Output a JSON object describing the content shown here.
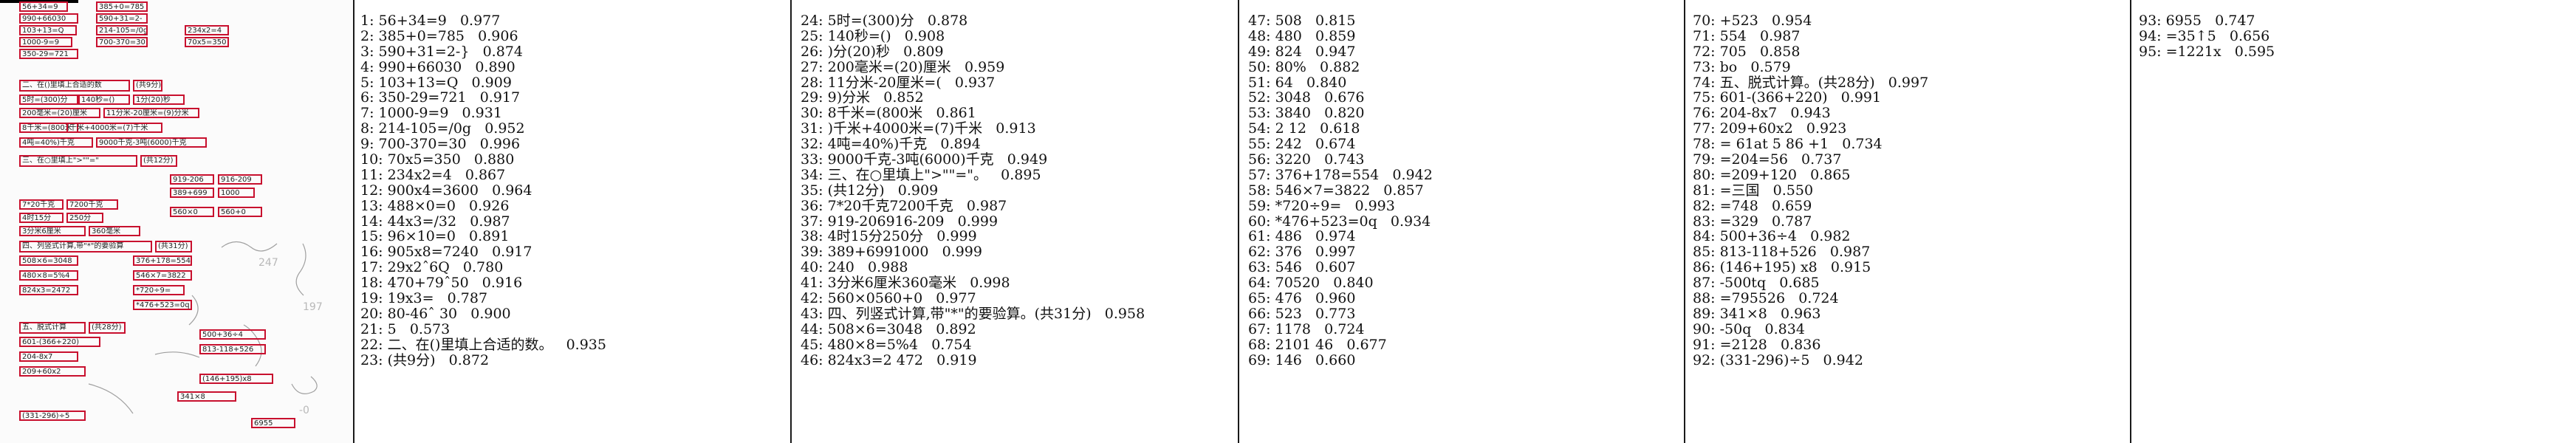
{
  "columns": [
    {
      "rows": [
        {
          "idx": "1:",
          "text": "56+34=9",
          "score": "0.977"
        },
        {
          "idx": "2:",
          "text": "385+0=785",
          "score": "0.906"
        },
        {
          "idx": "3:",
          "text": "590+31=2-}",
          "score": "0.874"
        },
        {
          "idx": "4:",
          "text": "990+66030",
          "score": "0.890"
        },
        {
          "idx": "5:",
          "text": "103+13=Q",
          "score": "0.909"
        },
        {
          "idx": "6:",
          "text": "350-29=721",
          "score": "0.917"
        },
        {
          "idx": "7:",
          "text": "1000-9=9",
          "score": "0.931"
        },
        {
          "idx": "8:",
          "text": "214-105=/0g",
          "score": "0.952"
        },
        {
          "idx": "9:",
          "text": "700-370=30",
          "score": "0.996"
        },
        {
          "idx": "10:",
          "text": "70x5=350",
          "score": "0.880"
        },
        {
          "idx": "11:",
          "text": "234x2=4",
          "score": "0.867"
        },
        {
          "idx": "12:",
          "text": "900x4=3600",
          "score": "0.964"
        },
        {
          "idx": "13:",
          "text": "488×0=0",
          "score": "0.926"
        },
        {
          "idx": "14:",
          "text": "44x3=/32",
          "score": "0.987"
        },
        {
          "idx": "15:",
          "text": "96×10=0",
          "score": "0.891"
        },
        {
          "idx": "16:",
          "text": "905x8=7240",
          "score": "0.917"
        },
        {
          "idx": "17:",
          "text": "29x2ˆ6Q",
          "score": "0.780"
        },
        {
          "idx": "18:",
          "text": "470+79ˆ50",
          "score": "0.916"
        },
        {
          "idx": "19:",
          "text": "19x3=",
          "score": "0.787"
        },
        {
          "idx": "20:",
          "text": "80-46ˆ 30",
          "score": "0.900"
        },
        {
          "idx": "21:",
          "text": "5",
          "score": "0.573"
        },
        {
          "idx": "22:",
          "text": "二、在()里填上合适的数。",
          "score": "0.935"
        },
        {
          "idx": "23:",
          "text": "(共9分)",
          "score": "0.872"
        }
      ]
    },
    {
      "rows": [
        {
          "idx": "24:",
          "text": "5时=(300)分",
          "score": "0.878"
        },
        {
          "idx": "25:",
          "text": "140秒=()",
          "score": "0.908"
        },
        {
          "idx": "26:",
          "text": ")分(20)秒",
          "score": "0.809"
        },
        {
          "idx": "27:",
          "text": "200毫米=(20)厘米",
          "score": "0.959"
        },
        {
          "idx": "28:",
          "text": "11分米-20厘米=(",
          "score": "0.937"
        },
        {
          "idx": "29:",
          "text": "9)分米",
          "score": "0.852"
        },
        {
          "idx": "30:",
          "text": "8千米=(800米",
          "score": "0.861"
        },
        {
          "idx": "31:",
          "text": ")千米+4000米=(7)千米",
          "score": "0.913"
        },
        {
          "idx": "32:",
          "text": "4吨=40%)千克",
          "score": "0.894"
        },
        {
          "idx": "33:",
          "text": "9000千克-3吨(6000)千克",
          "score": "0.949"
        },
        {
          "idx": "34:",
          "text": "三、在○里填上\">\"\"=\"。",
          "score": "0.895"
        },
        {
          "idx": "35:",
          "text": "(共12分)",
          "score": "0.909"
        },
        {
          "idx": "36:",
          "text": "7*20千克7200千克",
          "score": "0.987"
        },
        {
          "idx": "37:",
          "text": "919-206916-209",
          "score": "0.999"
        },
        {
          "idx": "38:",
          "text": "4时15分250分",
          "score": "0.999"
        },
        {
          "idx": "39:",
          "text": "389+6991000",
          "score": "0.999"
        },
        {
          "idx": "40:",
          "text": "240",
          "score": "0.988"
        },
        {
          "idx": "41:",
          "text": "3分米6厘米360毫米",
          "score": "0.998"
        },
        {
          "idx": "42:",
          "text": "560×0560+0",
          "score": "0.977"
        },
        {
          "idx": "43:",
          "text": "四、列竖式计算,带\"*\"的要验算。(共31分)",
          "score": "0.958"
        },
        {
          "idx": "44:",
          "text": "508×6=3048",
          "score": "0.892"
        },
        {
          "idx": "45:",
          "text": "480×8=5%4",
          "score": "0.754"
        },
        {
          "idx": "46:",
          "text": "824x3=2 472",
          "score": "0.919"
        }
      ]
    },
    {
      "rows": [
        {
          "idx": "47:",
          "text": "508",
          "score": "0.815"
        },
        {
          "idx": "48:",
          "text": "480",
          "score": "0.859"
        },
        {
          "idx": "49:",
          "text": "824",
          "score": "0.947"
        },
        {
          "idx": "50:",
          "text": "80%",
          "score": "0.882"
        },
        {
          "idx": "51:",
          "text": "64",
          "score": "0.840"
        },
        {
          "idx": "52:",
          "text": "3048",
          "score": "0.676"
        },
        {
          "idx": "53:",
          "text": "3840",
          "score": "0.820"
        },
        {
          "idx": "54:",
          "text": "2 12",
          "score": "0.618"
        },
        {
          "idx": "55:",
          "text": "242",
          "score": "0.674"
        },
        {
          "idx": "56:",
          "text": "3220",
          "score": "0.743"
        },
        {
          "idx": "57:",
          "text": "376+178=554",
          "score": "0.942"
        },
        {
          "idx": "58:",
          "text": "546×7=3822",
          "score": "0.857"
        },
        {
          "idx": "59:",
          "text": "*720÷9=",
          "score": "0.993"
        },
        {
          "idx": "60:",
          "text": "*476+523=0q",
          "score": "0.934"
        },
        {
          "idx": "61:",
          "text": "486",
          "score": "0.974"
        },
        {
          "idx": "62:",
          "text": "376",
          "score": "0.997"
        },
        {
          "idx": "63:",
          "text": "546",
          "score": "0.607"
        },
        {
          "idx": "64:",
          "text": "70520",
          "score": "0.840"
        },
        {
          "idx": "65:",
          "text": "476",
          "score": "0.960"
        },
        {
          "idx": "66:",
          "text": "523",
          "score": "0.773"
        },
        {
          "idx": "67:",
          "text": "1178",
          "score": "0.724"
        },
        {
          "idx": "68:",
          "text": "2101 46",
          "score": "0.677"
        },
        {
          "idx": "69:",
          "text": "146",
          "score": "0.660"
        }
      ]
    },
    {
      "rows": [
        {
          "idx": "70:",
          "text": "+523",
          "score": "0.954"
        },
        {
          "idx": "71:",
          "text": "554",
          "score": "0.987"
        },
        {
          "idx": "72:",
          "text": "705",
          "score": "0.858"
        },
        {
          "idx": "73:",
          "text": "bo",
          "score": "0.579"
        },
        {
          "idx": "74:",
          "text": "五、脱式计算。(共28分)",
          "score": "0.997"
        },
        {
          "idx": "75:",
          "text": "601-(366+220)",
          "score": "0.991"
        },
        {
          "idx": "76:",
          "text": "204-8x7",
          "score": "0.943"
        },
        {
          "idx": "77:",
          "text": "209+60x2",
          "score": "0.923"
        },
        {
          "idx": "78:",
          "text": "= 61at 5 86 +1",
          "score": "0.734"
        },
        {
          "idx": "79:",
          "text": "=204=56",
          "score": "0.737"
        },
        {
          "idx": "80:",
          "text": "=209+120",
          "score": "0.865"
        },
        {
          "idx": "81:",
          "text": "=三国",
          "score": "0.550"
        },
        {
          "idx": "82:",
          "text": "=748",
          "score": "0.659"
        },
        {
          "idx": "83:",
          "text": "=329",
          "score": "0.787"
        },
        {
          "idx": "84:",
          "text": "500+36÷4",
          "score": "0.982"
        },
        {
          "idx": "85:",
          "text": "813-118+526",
          "score": "0.987"
        },
        {
          "idx": "86:",
          "text": "(146+195) x8",
          "score": "0.915"
        },
        {
          "idx": "87:",
          "text": "-500tq",
          "score": "0.685"
        },
        {
          "idx": "88:",
          "text": "=795526",
          "score": "0.724"
        },
        {
          "idx": "89:",
          "text": "341×8",
          "score": "0.963"
        },
        {
          "idx": "90:",
          "text": "-50q",
          "score": "0.834"
        },
        {
          "idx": "91:",
          "text": "=2128",
          "score": "0.836"
        },
        {
          "idx": "92:",
          "text": "(331-296)÷5",
          "score": "0.942"
        }
      ]
    },
    {
      "rows": [
        {
          "idx": "93:",
          "text": "6955",
          "score": "0.747"
        },
        {
          "idx": "94:",
          "text": "=35↑5",
          "score": "0.656"
        },
        {
          "idx": "95:",
          "text": "=1221x",
          "score": "0.595"
        }
      ]
    }
  ],
  "scan_boxes": [
    "56+34=9",
    "385+0=785",
    "990+66030",
    "590+31=2-",
    "103+13=Q",
    "1000-9=9",
    "350-29=721",
    "214-105=/0g",
    "700-370=30",
    "234x2=4",
    "70x5=350",
    "二、在()里填上合适的数",
    "(共9分)",
    "5时=(300)分",
    "140秒=()",
    "1分(20)秒",
    "200毫米=(20)厘米",
    "11分米-20厘米=(9)分米",
    "8千米=(800米",
    "千米+4000米=(7)千米",
    "4吨=40%)千克",
    "9000千克-3吨(6000)千克",
    "三、在○里填上\">\"\"=\"",
    "(共12分)",
    "919-206",
    "916-209",
    "389+699",
    "1000",
    "7*20千克",
    "7200千克",
    "4时15分",
    "250分",
    "3分米6厘米",
    "360毫米",
    "560×0",
    "560+0",
    "四、列竖式计算,带\"*\"的要验算",
    "(共31分)",
    "508×6=3048",
    "480×8=5%4",
    "824x3=2472",
    "376+178=554",
    "546×7=3822",
    "*720÷9=",
    "*476+523=0q",
    "五、脱式计算",
    "(共28分)",
    "601-(366+220)",
    "204-8x7",
    "209+60x2",
    "500+36÷4",
    "813-118+526",
    "(146+195)x8",
    "341×8",
    "(331-296)÷5",
    "6955"
  ]
}
